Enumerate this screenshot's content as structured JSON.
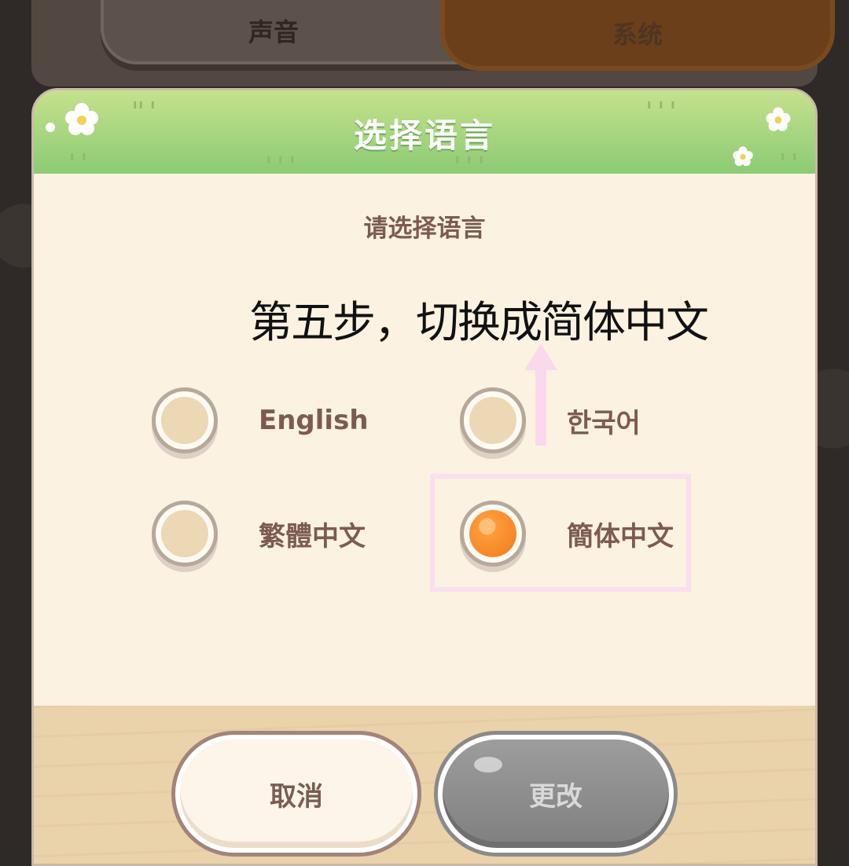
{
  "tabs": {
    "sound_label": "声音",
    "system_label": "系统"
  },
  "dialog": {
    "title": "选择语言",
    "subtitle": "请选择语言",
    "annotation": "第五步，切换成简体中文",
    "options": [
      {
        "label": "English",
        "selected": false
      },
      {
        "label": "한국어",
        "selected": false
      },
      {
        "label": "繁體中文",
        "selected": false
      },
      {
        "label": "簡体中文",
        "selected": true
      }
    ],
    "cancel_label": "取消",
    "change_label": "更改"
  },
  "colors": {
    "header_green": "#8ccb74",
    "selected_orange": "#f07b1a",
    "highlight_pink": "#f9dfef",
    "arrow_pink": "#fbd9ec"
  }
}
